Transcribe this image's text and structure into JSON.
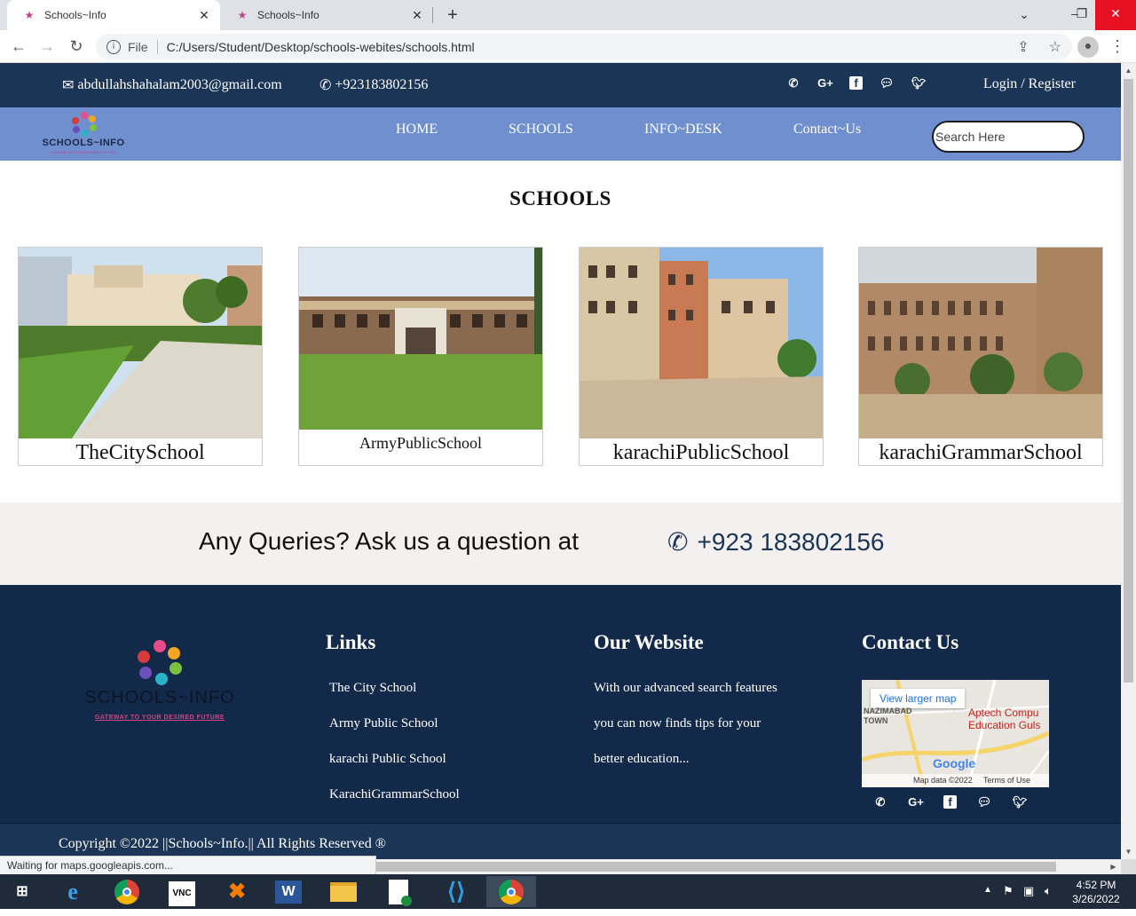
{
  "browser": {
    "tabs": [
      {
        "title": "Schools~Info",
        "active": true
      },
      {
        "title": "Schools~Info",
        "active": false
      }
    ],
    "file_label": "File",
    "url": "C:/Users/Student/Desktop/schools-webites/schools.html",
    "status": "Waiting for maps.googleapis.com..."
  },
  "topbar": {
    "email": "abdullahshahalam2003@gmail.com",
    "phone": "+923183802156",
    "socials": [
      "viber-icon",
      "google-plus-icon",
      "facebook-icon",
      "messenger-icon",
      "twitter-icon"
    ],
    "login": "Login / Register"
  },
  "navbar": {
    "logo_text": "SCHOOLS~INFO",
    "logo_tagline": "GATEWAY TO YOUR DESIRED FUTURE",
    "links": [
      "HOME",
      "SCHOOLS",
      "INFO~DESK",
      "Contact~Us"
    ],
    "search_placeholder": "Search Here"
  },
  "schools": {
    "title": "SCHOOLS",
    "cards": [
      {
        "name": "TheCitySchool"
      },
      {
        "name": "ArmyPublicSchool"
      },
      {
        "name": "karachiPublicSchool"
      },
      {
        "name": "karachiGrammarSchool"
      }
    ]
  },
  "query": {
    "text": "Any Queries? Ask us a question at",
    "phone": "+923 183802156"
  },
  "footer": {
    "logo_text": "SCHOOLS~INFO",
    "logo_tagline": "GATEWAY TO YOUR DESIRED FUTURE",
    "links_heading": "Links",
    "links": [
      "The City School",
      "Army Public School",
      "karachi Public School",
      "KarachiGrammarSchool"
    ],
    "website_heading": "Our Website",
    "website_lines": [
      "With our advanced search features",
      "you can now finds tips for your",
      "better education..."
    ],
    "contact_heading": "Contact Us",
    "map": {
      "view_larger": "View larger map",
      "place": "Aptech Compu\nEducation Guls",
      "town": "NAZIMABAD\nTOWN",
      "google": "Google",
      "attribution": "Map data ©2022     Terms of Use"
    },
    "copyright": "Copyright ©2022 ||Schools~Info.|| All Rights Reserved ®"
  },
  "taskbar": {
    "time": "4:52 PM",
    "date": "3/26/2022"
  },
  "colors": {
    "topbar": "#1b3557",
    "navbar": "#6f8fcf",
    "footer": "#13294a",
    "query_band": "#f3f0ef"
  }
}
